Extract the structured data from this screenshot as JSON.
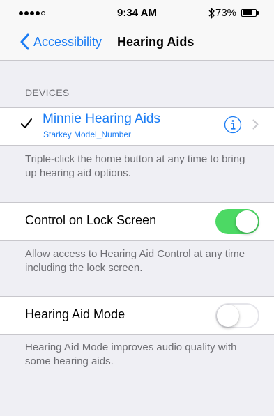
{
  "status_bar": {
    "time": "9:34 AM",
    "battery_text": "73%",
    "battery_level": 0.73,
    "signal_bars_filled": 4,
    "signal_bars_total": 5
  },
  "nav": {
    "back_label": "Accessibility",
    "title": "Hearing Aids"
  },
  "devices": {
    "header": "DEVICES",
    "device": {
      "name": "Minnie Hearing Aids",
      "model": "Starkey Model_Number",
      "selected": true
    },
    "footer": "Triple-click the home button at any time to bring up hearing aid options."
  },
  "lock_screen": {
    "label": "Control on Lock Screen",
    "enabled": true,
    "footer": "Allow access to Hearing Aid Control at any time including the lock screen."
  },
  "hearing_aid_mode": {
    "label": "Hearing Aid Mode",
    "enabled": false,
    "footer": "Hearing Aid Mode improves audio quality with some hearing aids."
  },
  "colors": {
    "tint": "#1a7cf4",
    "toggle_on": "#4cd964",
    "background": "#efeff4",
    "secondary_text": "#6d6d72"
  },
  "icons": {
    "back": "chevron-left-icon",
    "selected": "checkmark-icon",
    "info": "info-circle-icon",
    "disclosure": "chevron-right-icon",
    "bluetooth": "bluetooth-icon",
    "battery": "battery-icon"
  }
}
